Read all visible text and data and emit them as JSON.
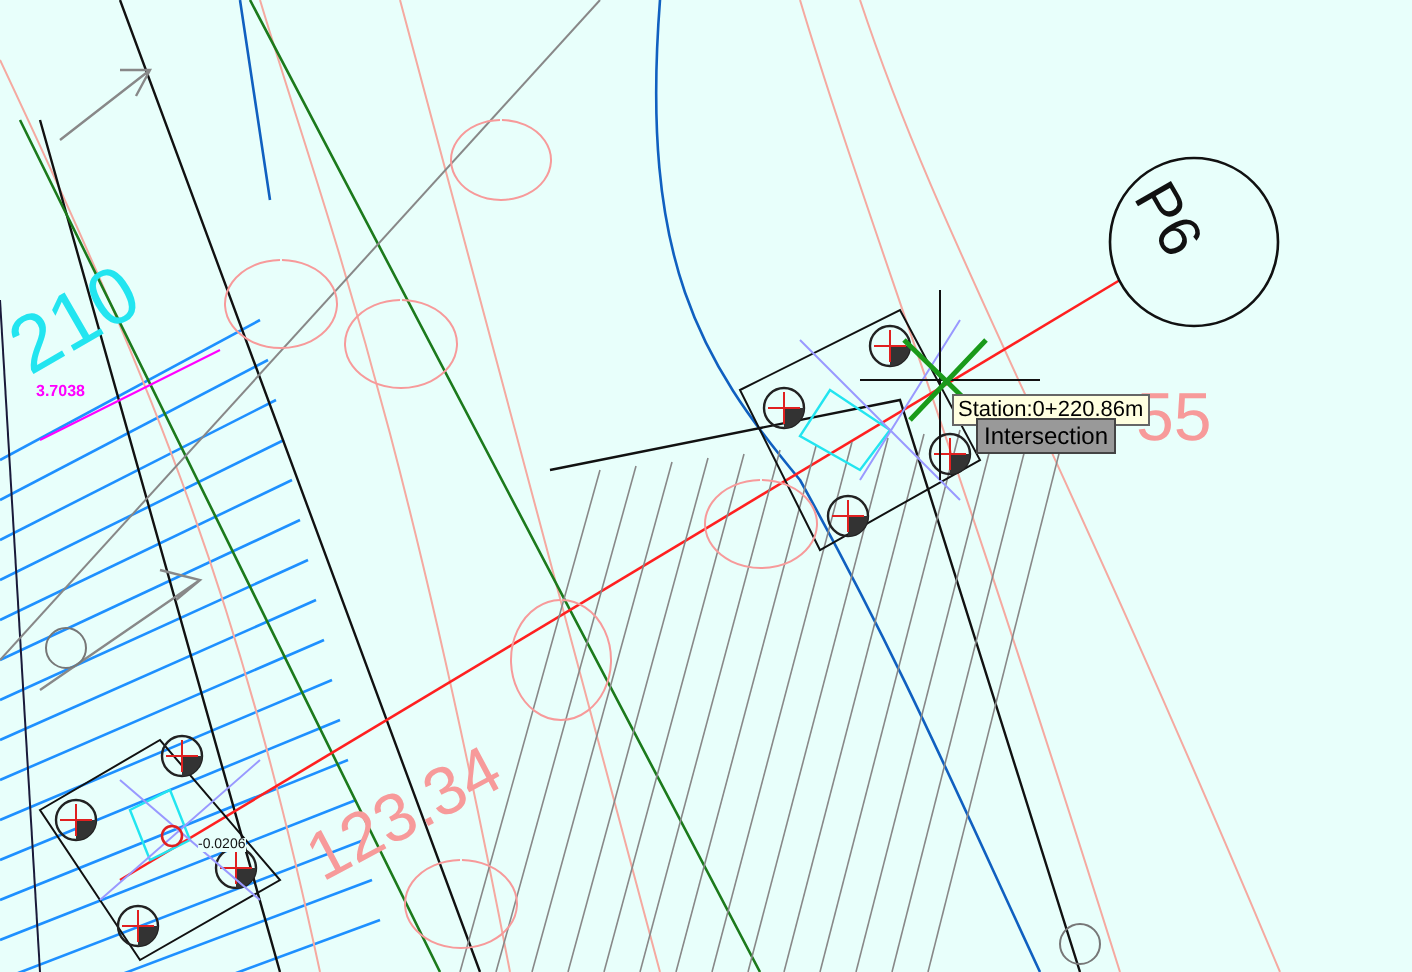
{
  "canvas": {
    "labels": [
      {
        "text": "P6",
        "kind": "marker"
      },
      {
        "text": "210",
        "kind": "area"
      },
      {
        "text": "3.7038",
        "kind": "dimension"
      },
      {
        "text": "55",
        "kind": "station"
      },
      {
        "text": "123.34",
        "kind": "station"
      },
      {
        "text": "-0.0206",
        "kind": "offset"
      }
    ]
  },
  "tooltip": {
    "station": "Station:0+220.86m",
    "snap": "Intersection"
  }
}
